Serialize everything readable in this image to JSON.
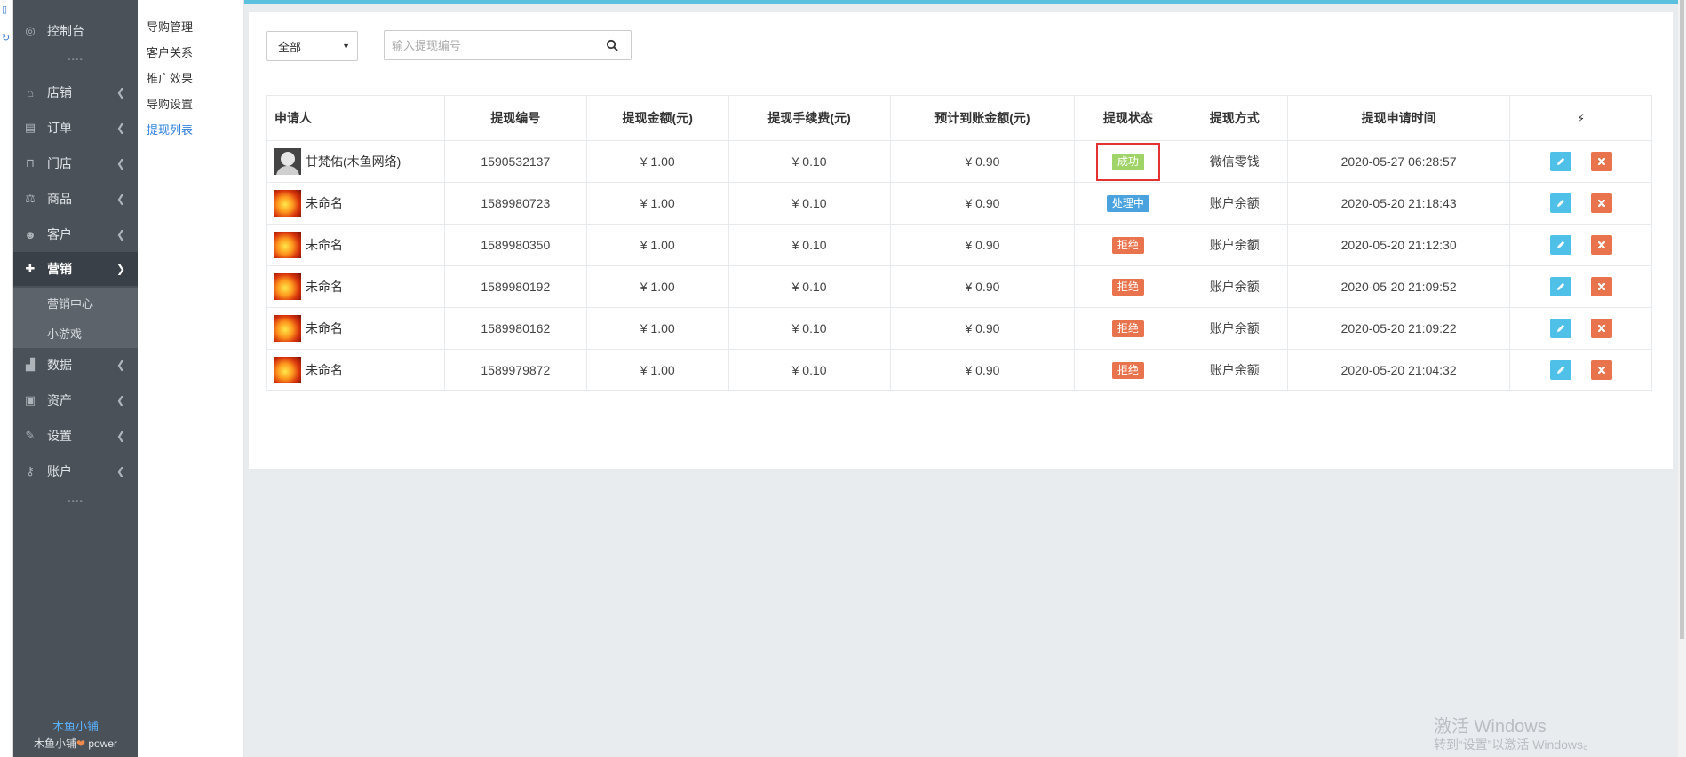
{
  "colors": {
    "accent": "#5bc0de",
    "sidebar_bg": "#4a5159",
    "link": "#2f7fe0",
    "status_success": "#a0d468",
    "status_processing": "#4aa3df",
    "status_rejected": "#e8734c",
    "edit_button": "#4fc1e9",
    "delete_button": "#e8734c",
    "highlight_border": "#e33232"
  },
  "sidebar": {
    "items": [
      {
        "label": "控制台",
        "icon": "dashboard-icon"
      },
      {
        "label": "店铺",
        "icon": "store-icon"
      },
      {
        "label": "订单",
        "icon": "order-icon"
      },
      {
        "label": "门店",
        "icon": "branch-icon"
      },
      {
        "label": "商品",
        "icon": "scale-icon"
      },
      {
        "label": "客户",
        "icon": "users-icon"
      },
      {
        "label": "营销",
        "icon": "gift-icon"
      },
      {
        "label": "数据",
        "icon": "chart-icon"
      },
      {
        "label": "资产",
        "icon": "money-icon"
      },
      {
        "label": "设置",
        "icon": "wrench-icon"
      },
      {
        "label": "账户",
        "icon": "key-icon"
      }
    ],
    "marketing_sub": [
      "营销中心",
      "小游戏"
    ],
    "footer_brand": "木鱼小铺",
    "footer_brand_name": "木鱼小铺",
    "footer_power": "power"
  },
  "subnav": {
    "items": [
      "导购管理",
      "客户关系",
      "推广效果",
      "导购设置",
      "提现列表"
    ],
    "current": "提现列表"
  },
  "filter": {
    "selected": "全部"
  },
  "search": {
    "placeholder": "输入提现编号"
  },
  "table": {
    "headers": [
      "申请人",
      "提现编号",
      "提现金额(元)",
      "提现手续费(元)",
      "预计到账金额(元)",
      "提现状态",
      "提现方式",
      "提现申请时间",
      "⚡"
    ],
    "rows": [
      {
        "name": "甘梵佑(木鱼网络)",
        "avatar": "photo",
        "id": "1590532137",
        "amount": "¥ 1.00",
        "fee": "¥ 0.10",
        "net": "¥ 0.90",
        "status": "成功",
        "status_type": "success",
        "method": "微信零钱",
        "time": "2020-05-27 06:28:57",
        "highlighted": true
      },
      {
        "name": "未命名",
        "avatar": "fire",
        "id": "1589980723",
        "amount": "¥ 1.00",
        "fee": "¥ 0.10",
        "net": "¥ 0.90",
        "status": "处理中",
        "status_type": "processing",
        "method": "账户余额",
        "time": "2020-05-20 21:18:43"
      },
      {
        "name": "未命名",
        "avatar": "fire",
        "id": "1589980350",
        "amount": "¥ 1.00",
        "fee": "¥ 0.10",
        "net": "¥ 0.90",
        "status": "拒绝",
        "status_type": "rejected",
        "method": "账户余额",
        "time": "2020-05-20 21:12:30"
      },
      {
        "name": "未命名",
        "avatar": "fire",
        "id": "1589980192",
        "amount": "¥ 1.00",
        "fee": "¥ 0.10",
        "net": "¥ 0.90",
        "status": "拒绝",
        "status_type": "rejected",
        "method": "账户余额",
        "time": "2020-05-20 21:09:52"
      },
      {
        "name": "未命名",
        "avatar": "fire",
        "id": "1589980162",
        "amount": "¥ 1.00",
        "fee": "¥ 0.10",
        "net": "¥ 0.90",
        "status": "拒绝",
        "status_type": "rejected",
        "method": "账户余额",
        "time": "2020-05-20 21:09:22"
      },
      {
        "name": "未命名",
        "avatar": "fire",
        "id": "1589979872",
        "amount": "¥ 1.00",
        "fee": "¥ 0.10",
        "net": "¥ 0.90",
        "status": "拒绝",
        "status_type": "rejected",
        "method": "账户余额",
        "time": "2020-05-20 21:04:32"
      }
    ]
  },
  "watermark": {
    "line1": "激活 Windows",
    "line2": "转到“设置”以激活 Windows。"
  }
}
